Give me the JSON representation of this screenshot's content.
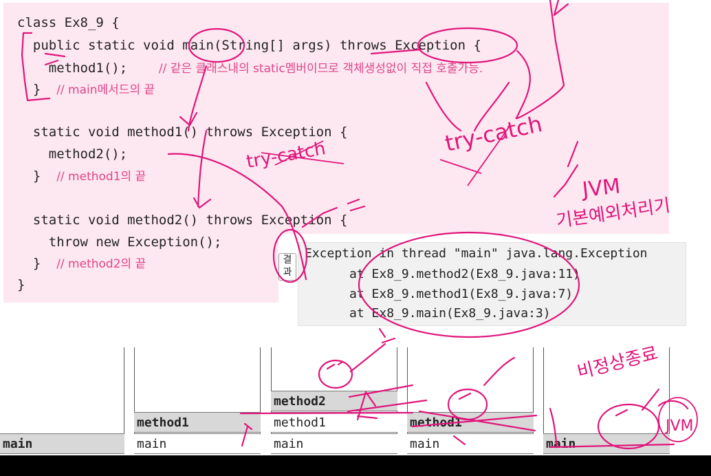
{
  "code": {
    "l1": "class Ex8_9 {",
    "l2": "  public static void main(String[] args) throws Exception {",
    "l3_code": "    method1();    ",
    "l3_comment": "// 같은 클래스내의 static멤버이므로 객체생성없이 직접 호출가능.",
    "l4_code": "  }  ",
    "l4_comment": "// main메서드의 끝",
    "l5": "  static void method1() throws Exception {",
    "l6": "    method2();",
    "l7_code": "  }  ",
    "l7_comment": "// method1의 끝",
    "l8": "  static void method2() throws Exception {",
    "l9": "    throw new Exception();",
    "l10_code": "  }  ",
    "l10_comment": "// method2의 끝",
    "l11": "}"
  },
  "output": {
    "label": "결과",
    "line1": "Exception in thread \"main\" java.lang.Exception",
    "line2": "      at Ex8_9.method2(Ex8_9.java:11)",
    "line3": "      at Ex8_9.method1(Ex8_9.java:7)",
    "line4": "      at Ex8_9.main(Ex8_9.java:3)"
  },
  "stack": {
    "col1": [
      "main"
    ],
    "col2": [
      "method1",
      "main"
    ],
    "col3": [
      "method2",
      "method1",
      "main"
    ],
    "col4": [
      "method1",
      "main"
    ],
    "col5": [
      "main"
    ]
  },
  "annotations": {
    "a1": "try-catch",
    "a2": "JVM",
    "a3": "기본예외처리기",
    "a4": "비정상종료",
    "a5": "JVM"
  }
}
